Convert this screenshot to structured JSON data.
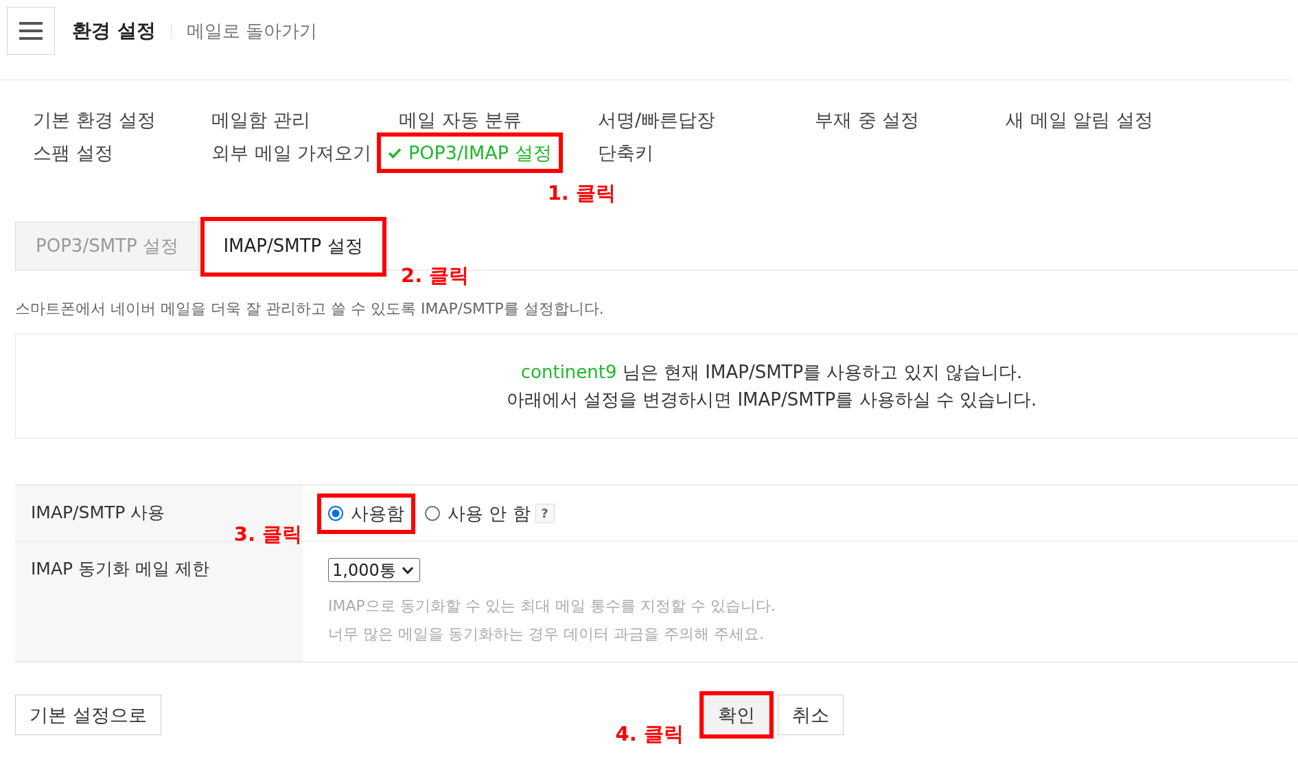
{
  "header": {
    "title": "환경 설정",
    "back_link": "메일로 돌아가기"
  },
  "settings_menu": [
    {
      "label": "기본 환경 설정",
      "selected": false
    },
    {
      "label": "메일함 관리",
      "selected": false
    },
    {
      "label": "메일 자동 분류",
      "selected": false
    },
    {
      "label": "서명/빠른답장",
      "selected": false
    },
    {
      "label": "부재 중 설정",
      "selected": false
    },
    {
      "label": "새 메일 알림 설정",
      "selected": false
    },
    {
      "label": "스팸 설정",
      "selected": false
    },
    {
      "label": "외부 메일 가져오기",
      "selected": false
    },
    {
      "label": "POP3/IMAP 설정",
      "selected": true,
      "callout": "1. 클릭"
    },
    {
      "label": "단축키",
      "selected": false
    }
  ],
  "mode_tabs": [
    {
      "label": "POP3/SMTP 설정",
      "selected": false
    },
    {
      "label": "IMAP/SMTP 설정",
      "selected": true,
      "callout": "2. 클릭"
    }
  ],
  "description": "스마트폰에서 네이버 메일을 더욱 잘 관리하고 쓸 수 있도록 IMAP/SMTP를 설정합니다.",
  "notice": {
    "user_id": "continent9",
    "message": "님은 현재 IMAP/SMTP를 사용하고 있지 않습니다.",
    "detail": "아래에서 설정을 변경하시면 IMAP/SMTP를 사용하실 수 있습니다."
  },
  "settings": [
    {
      "label": "IMAP/SMTP 사용",
      "kind": "radio",
      "options": [
        {
          "label": "사용함",
          "selected": true,
          "callout": "3. 클릭"
        },
        {
          "label": "사용 안 함",
          "selected": false
        }
      ],
      "help": "?"
    },
    {
      "label": "IMAP 동기화 메일 제한",
      "kind": "select",
      "value": "1,000통",
      "hints": [
        "IMAP으로 동기화할 수 있는 최대 메일 통수를 지정할 수 있습니다.",
        "너무 많은 메일을 동기화하는 경우 데이터 과금을 주의해 주세요."
      ]
    }
  ],
  "footer": {
    "reset_button": "기본 설정으로",
    "actions": [
      {
        "label": "확인",
        "kind": "confirm",
        "callout": "4. 클릭"
      },
      {
        "label": "취소",
        "kind": "cancel"
      }
    ]
  }
}
